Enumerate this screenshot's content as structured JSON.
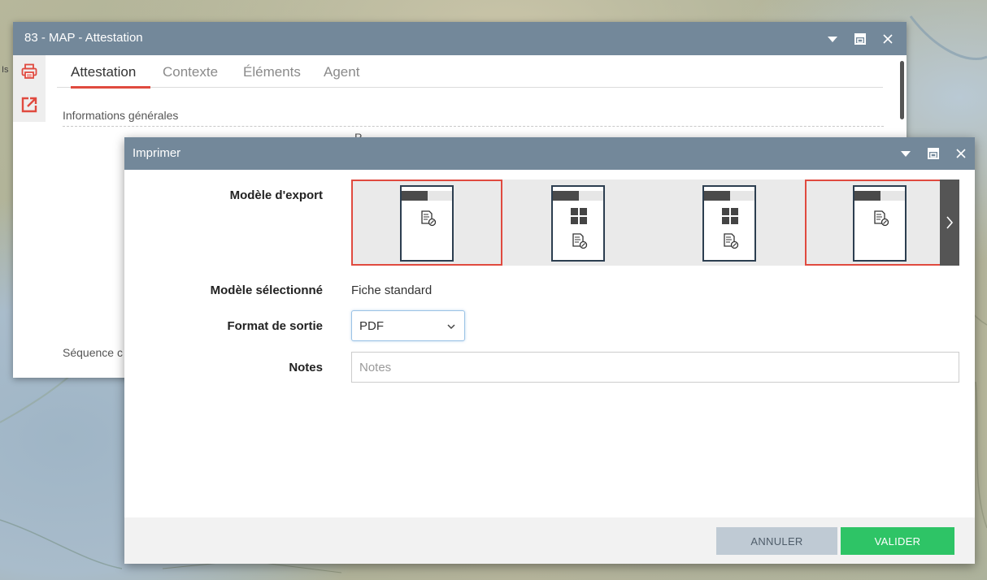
{
  "map": {
    "edge_label": "Is"
  },
  "back_window": {
    "title": "83 - MAP - Attestation",
    "tabs": [
      {
        "label": "Attestation",
        "active": true
      },
      {
        "label": "Contexte",
        "active": false
      },
      {
        "label": "Éléments",
        "active": false
      },
      {
        "label": "Agent",
        "active": false
      }
    ],
    "section_title": "Informations générales",
    "partial_text": "P",
    "footer_section": "Séquence c",
    "side_icons": [
      "printer-icon",
      "export-icon"
    ]
  },
  "dialog": {
    "title": "Imprimer",
    "labels": {
      "export_model": "Modèle d'export",
      "selected_model": "Modèle sélectionné",
      "output_format": "Format de sortie",
      "notes": "Notes"
    },
    "selected_model_value": "Fiche standard",
    "output_format_value": "PDF",
    "notes_placeholder": "Notes",
    "templates": [
      {
        "layout": "document",
        "selected": true
      },
      {
        "layout": "grid-document",
        "selected": false
      },
      {
        "layout": "grid-document",
        "selected": false
      },
      {
        "layout": "document",
        "selected": true
      }
    ],
    "buttons": {
      "cancel": "ANNULER",
      "ok": "VALIDER"
    }
  },
  "colors": {
    "titlebar": "#73889a",
    "accent_red": "#e04a3f",
    "valider_green": "#2ec466",
    "annuler_gray": "#bfcad4"
  }
}
